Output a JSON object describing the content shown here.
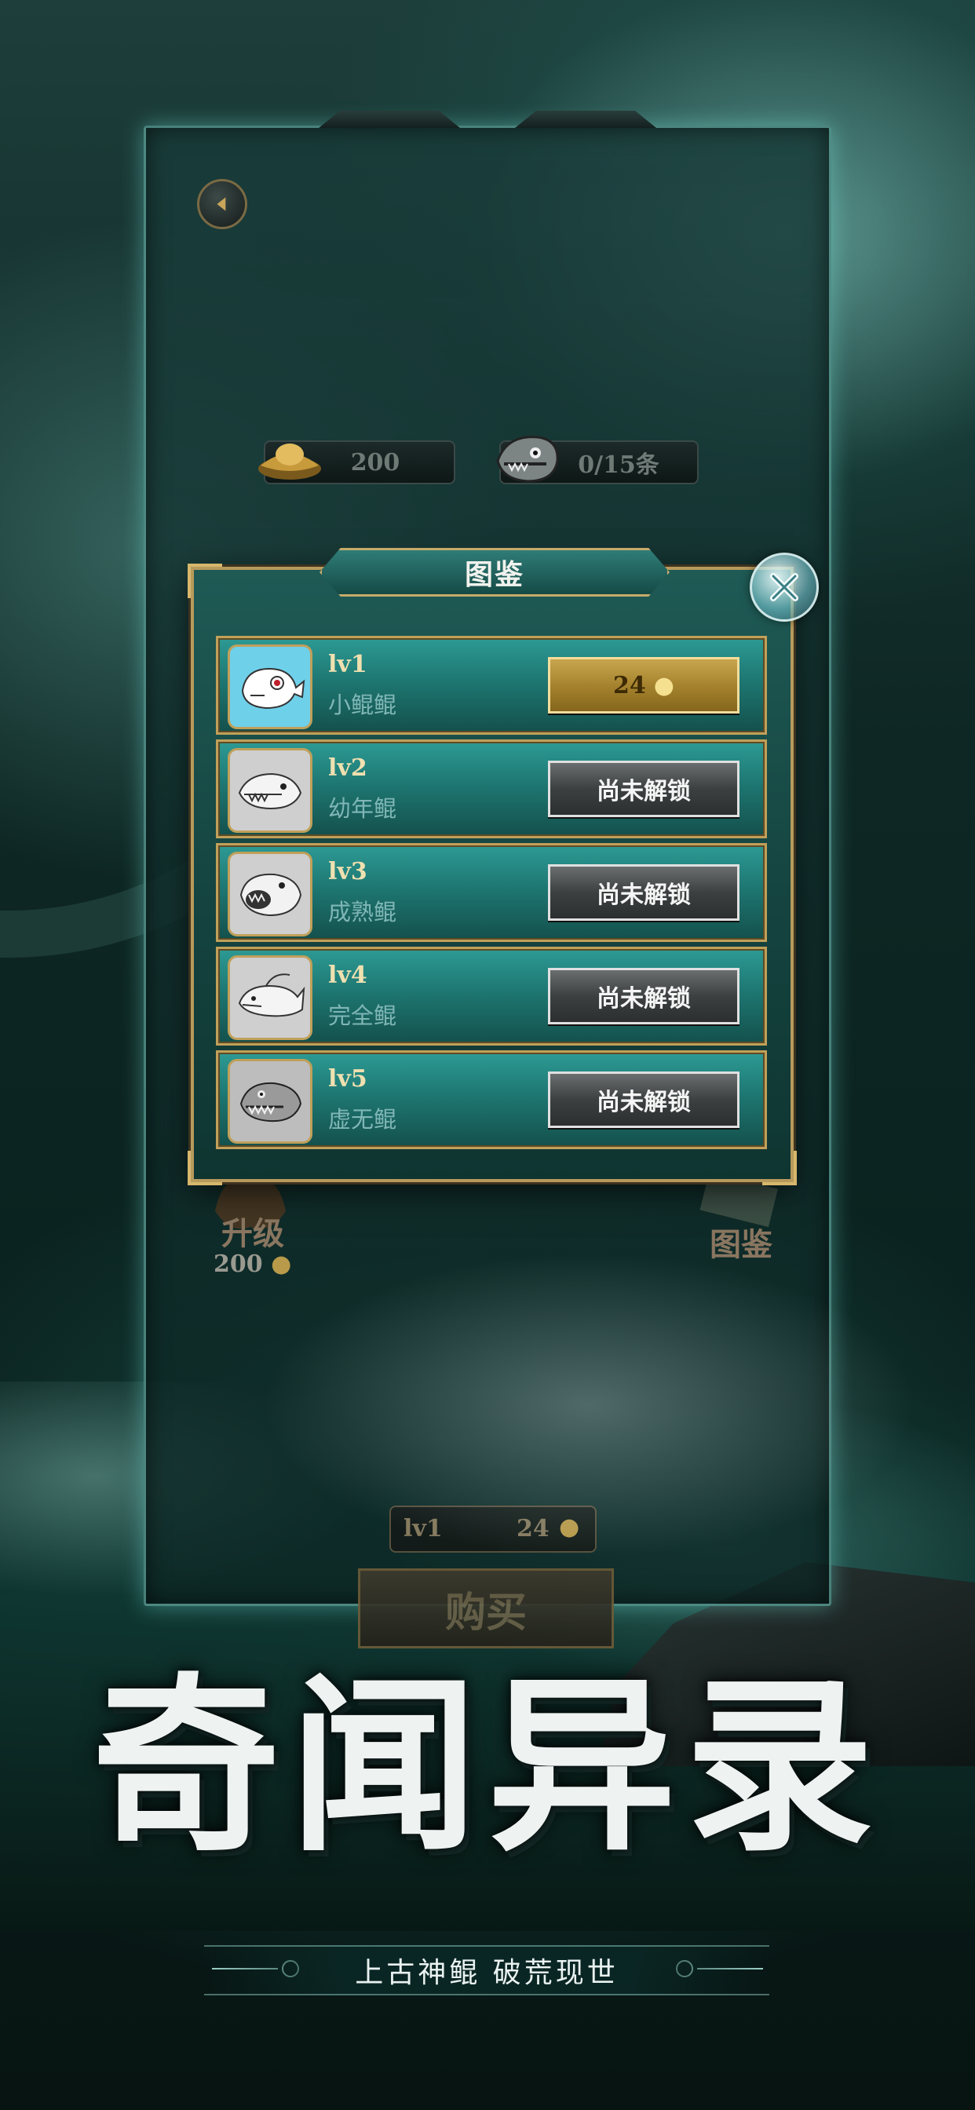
{
  "currency": {
    "gold": "200"
  },
  "collection": {
    "count": "0/15条"
  },
  "dialog": {
    "title": "图鉴",
    "rows": [
      {
        "level": "lv1",
        "name": "小鲲鲲",
        "button": "24",
        "state": "unlocked"
      },
      {
        "level": "lv2",
        "name": "幼年鲲",
        "button": "尚未解锁",
        "state": "locked"
      },
      {
        "level": "lv3",
        "name": "成熟鲲",
        "button": "尚未解锁",
        "state": "locked"
      },
      {
        "level": "lv4",
        "name": "完全鲲",
        "button": "尚未解锁",
        "state": "locked"
      },
      {
        "level": "lv5",
        "name": "虚无鲲",
        "button": "尚未解锁",
        "state": "locked"
      }
    ]
  },
  "bottom_menu": {
    "upgrade_label": "升级",
    "upgrade_cost": "200",
    "codex_label": "图鉴"
  },
  "purchase": {
    "level": "lv1",
    "price": "24",
    "buy_label": "购买"
  },
  "promo": {
    "title": "奇闻异录",
    "subtitle": "上古神鲲 破荒现世"
  },
  "colors": {
    "frame_gold": "#c0a05a",
    "row_teal": "#1e7772",
    "gold_button": "#a6832e",
    "locked_button": "#3c4040"
  },
  "icons": [
    "back-arrow-icon",
    "gold-ingot-icon",
    "fish-head-icon",
    "close-icon",
    "fish-icon",
    "dragon-emblem-icon",
    "book-icon"
  ]
}
